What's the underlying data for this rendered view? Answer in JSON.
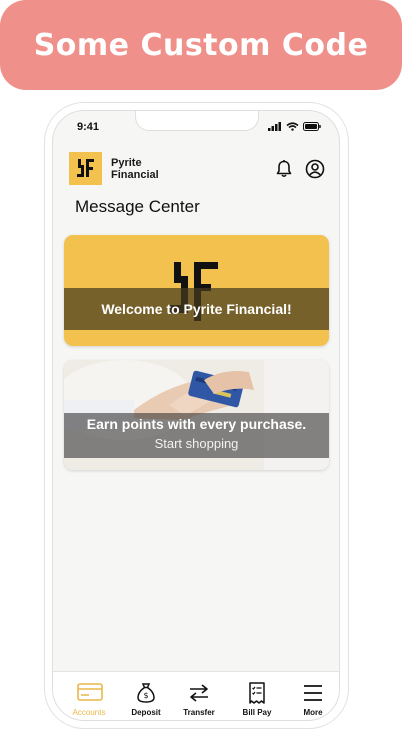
{
  "banner": {
    "title": "Some Custom Code"
  },
  "status_bar": {
    "time": "9:41"
  },
  "brand": {
    "line1": "Pyrite",
    "line2": "Financial"
  },
  "page": {
    "title": "Message Center"
  },
  "cards": [
    {
      "message": "Welcome to Pyrite Financial!"
    },
    {
      "message": "Earn points with every purchase.",
      "cta": "Start shopping"
    }
  ],
  "tabs": [
    {
      "label": "Accounts",
      "icon": "credit-card-icon",
      "active": true
    },
    {
      "label": "Deposit",
      "icon": "money-bag-icon",
      "active": false
    },
    {
      "label": "Transfer",
      "icon": "transfer-arrows-icon",
      "active": false
    },
    {
      "label": "Bill Pay",
      "icon": "bill-icon",
      "active": false
    },
    {
      "label": "More",
      "icon": "menu-icon",
      "active": false
    }
  ],
  "colors": {
    "brand_yellow": "#f2c14e",
    "banner_pink": "#f0908a",
    "active_tab": "#e9b84a"
  }
}
